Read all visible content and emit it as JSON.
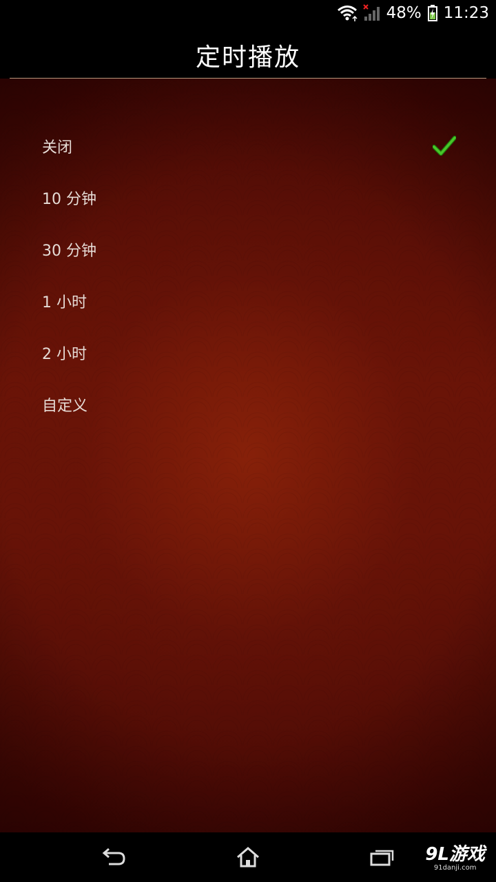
{
  "status_bar": {
    "battery": "48%",
    "time": "11:23",
    "icons": [
      "wifi-icon",
      "signal-icon",
      "battery-charging-icon"
    ]
  },
  "header": {
    "title": "定时播放"
  },
  "options": [
    {
      "label": "关闭",
      "selected": true
    },
    {
      "label": "10 分钟",
      "selected": false
    },
    {
      "label": "30 分钟",
      "selected": false
    },
    {
      "label": "1 小时",
      "selected": false
    },
    {
      "label": "2 小时",
      "selected": false
    },
    {
      "label": "自定义",
      "selected": false
    }
  ],
  "nav_bar": {
    "icons": [
      "back-icon",
      "home-icon",
      "recent-apps-icon"
    ]
  },
  "watermark": {
    "main": "9L游戏",
    "sub": "91danji.com"
  },
  "colors": {
    "check": "#3dbb1e",
    "background_accent": "#6a1306",
    "divider": "#b79a7e"
  }
}
